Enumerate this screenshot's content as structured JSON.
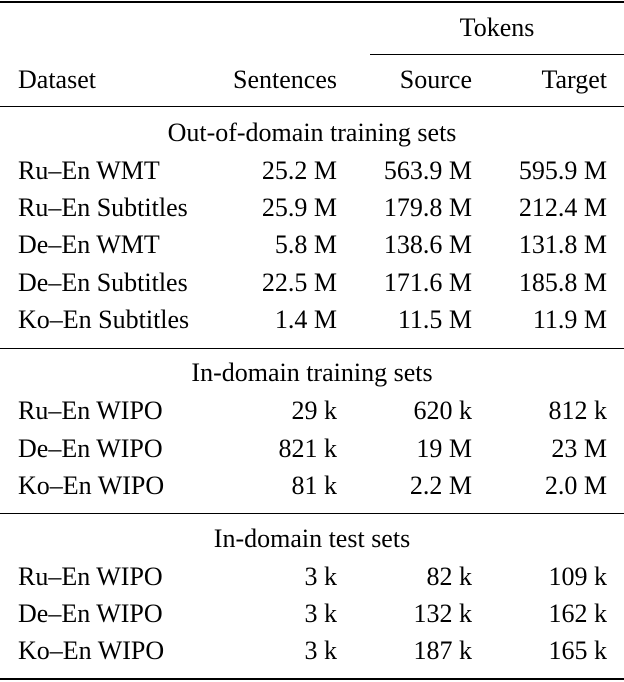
{
  "table": {
    "header": {
      "group_label": "Tokens",
      "columns": [
        "Dataset",
        "Sentences",
        "Source",
        "Target"
      ]
    },
    "sections": [
      {
        "title": "Out-of-domain training sets",
        "rows": [
          {
            "dataset": "Ru–En WMT",
            "sentences": "25.2 M",
            "source": "563.9 M",
            "target": "595.9 M"
          },
          {
            "dataset": "Ru–En Subtitles",
            "sentences": "25.9 M",
            "source": "179.8 M",
            "target": "212.4 M"
          },
          {
            "dataset": "De–En WMT",
            "sentences": "5.8 M",
            "source": "138.6 M",
            "target": "131.8 M"
          },
          {
            "dataset": "De–En Subtitles",
            "sentences": "22.5 M",
            "source": "171.6 M",
            "target": "185.8 M"
          },
          {
            "dataset": "Ko–En Subtitles",
            "sentences": "1.4 M",
            "source": "11.5 M",
            "target": "11.9 M"
          }
        ]
      },
      {
        "title": "In-domain training sets",
        "rows": [
          {
            "dataset": "Ru–En WIPO",
            "sentences": "29 k",
            "source": "620 k",
            "target": "812 k"
          },
          {
            "dataset": "De–En WIPO",
            "sentences": "821 k",
            "source": "19 M",
            "target": "23 M"
          },
          {
            "dataset": "Ko–En WIPO",
            "sentences": "81 k",
            "source": "2.2 M",
            "target": "2.0 M"
          }
        ]
      },
      {
        "title": "In-domain test sets",
        "rows": [
          {
            "dataset": "Ru–En WIPO",
            "sentences": "3 k",
            "source": "82 k",
            "target": "109 k"
          },
          {
            "dataset": "De–En WIPO",
            "sentences": "3 k",
            "source": "132 k",
            "target": "162 k"
          },
          {
            "dataset": "Ko–En WIPO",
            "sentences": "3 k",
            "source": "187 k",
            "target": "165 k"
          }
        ]
      }
    ]
  }
}
